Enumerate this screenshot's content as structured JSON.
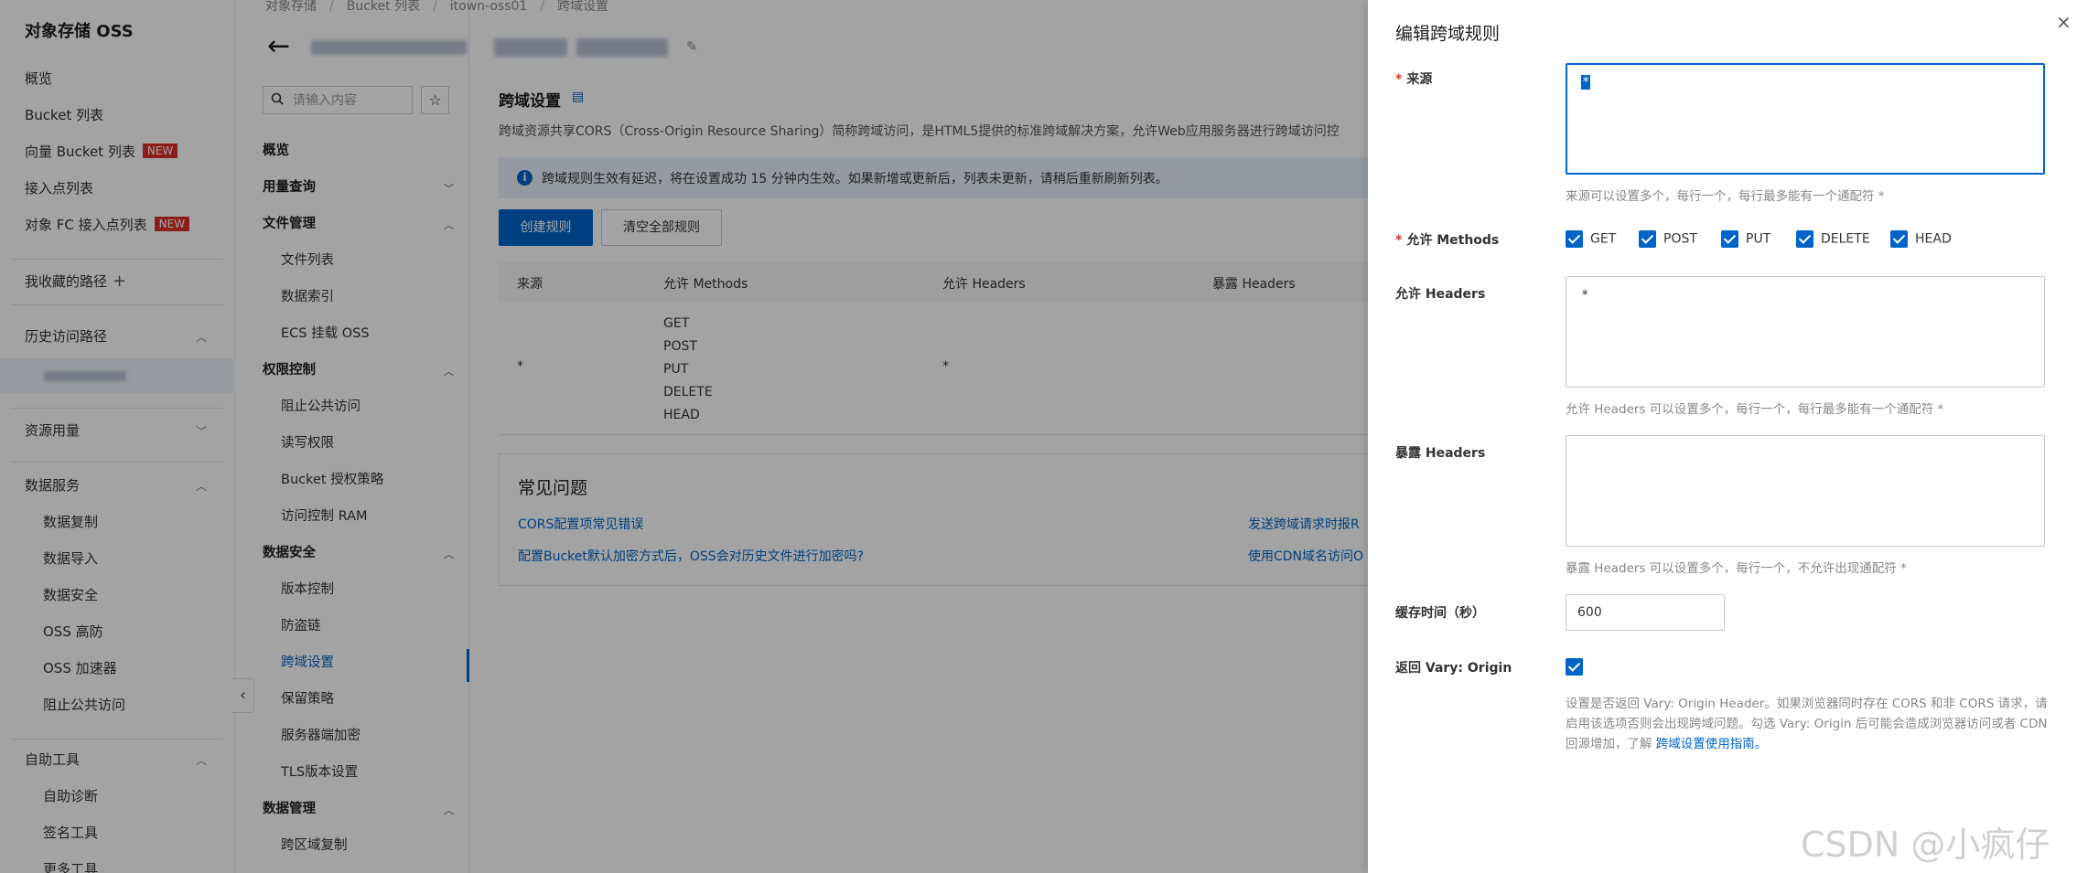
{
  "left_nav": {
    "title": "对象存储 OSS",
    "items": [
      {
        "label": "概览"
      },
      {
        "label": "Bucket 列表"
      },
      {
        "label": "向量 Bucket 列表",
        "badge": "NEW"
      },
      {
        "label": "接入点列表"
      },
      {
        "label": "对象 FC 接入点列表",
        "badge": "NEW"
      }
    ],
    "favorites": "我收藏的路径",
    "history": "历史访问路径",
    "resource_usage": "资源用量",
    "data_service": {
      "label": "数据服务",
      "items": [
        "数据复制",
        "数据导入",
        "数据安全",
        "OSS 高防",
        "OSS 加速器",
        "阻止公共访问"
      ]
    },
    "self_service": {
      "label": "自助工具",
      "items": [
        "自助诊断",
        "签名工具",
        "更多工具"
      ]
    }
  },
  "mid_nav": {
    "search_placeholder": "请输入内容",
    "star": "☆",
    "items": [
      {
        "label": "概览",
        "group": true
      },
      {
        "label": "用量查询",
        "group": true,
        "chevron": "down"
      },
      {
        "label": "文件管理",
        "group": true,
        "chevron": "up"
      },
      {
        "label": "文件列表",
        "sub": true
      },
      {
        "label": "数据索引",
        "sub": true
      },
      {
        "label": "ECS 挂载 OSS",
        "sub": true
      },
      {
        "label": "权限控制",
        "group": true,
        "chevron": "up"
      },
      {
        "label": "阻止公共访问",
        "sub": true
      },
      {
        "label": "读写权限",
        "sub": true
      },
      {
        "label": "Bucket 授权策略",
        "sub": true
      },
      {
        "label": "访问控制 RAM",
        "sub": true
      },
      {
        "label": "数据安全",
        "group": true,
        "chevron": "up"
      },
      {
        "label": "版本控制",
        "sub": true
      },
      {
        "label": "防盗链",
        "sub": true
      },
      {
        "label": "跨域设置",
        "sub": true,
        "active": true
      },
      {
        "label": "保留策略",
        "sub": true
      },
      {
        "label": "服务器端加密",
        "sub": true
      },
      {
        "label": "TLS版本设置",
        "sub": true
      },
      {
        "label": "数据管理",
        "group": true,
        "chevron": "up"
      },
      {
        "label": "跨区域复制",
        "sub": true
      }
    ]
  },
  "main": {
    "breadcrumb": [
      "对象存储",
      "Bucket 列表",
      "itown-oss01",
      "跨域设置"
    ],
    "section_title": "跨域设置",
    "description": "跨域资源共享CORS（Cross-Origin Resource Sharing）简称跨域访问，是HTML5提供的标准跨域解决方案，允许Web应用服务器进行跨域访问控",
    "notice": "跨域规则生效有延迟，将在设置成功 15 分钟内生效。如果新增或更新后，列表未更新，请稍后重新刷新列表。",
    "create_button": "创建规则",
    "clear_button": "清空全部规则",
    "table": {
      "headers": [
        "来源",
        "允许 Methods",
        "允许 Headers",
        "暴露 Headers"
      ],
      "row": {
        "origin": "*",
        "methods": [
          "GET",
          "POST",
          "PUT",
          "DELETE",
          "HEAD"
        ],
        "allow_headers": "*"
      }
    },
    "faq": {
      "title": "常见问题",
      "links": [
        "CORS配置项常见错误",
        "配置Bucket默认加密方式后，OSS会对历史文件进行加密吗?",
        "发送跨域请求时报R",
        "使用CDN域名访问O"
      ]
    }
  },
  "drawer": {
    "title": "编辑跨域规则",
    "close": "×",
    "origin": {
      "label": "来源",
      "value": "*",
      "hint": "来源可以设置多个，每行一个，每行最多能有一个通配符 *"
    },
    "methods": {
      "label": "允许 Methods",
      "options": [
        "GET",
        "POST",
        "PUT",
        "DELETE",
        "HEAD"
      ]
    },
    "allow_headers": {
      "label": "允许 Headers",
      "value": "*",
      "hint": "允许 Headers 可以设置多个，每行一个，每行最多能有一个通配符 *"
    },
    "expose_headers": {
      "label": "暴露 Headers",
      "value": "",
      "hint": "暴露 Headers 可以设置多个，每行一个，不允许出现通配符 *"
    },
    "cache": {
      "label": "缓存时间（秒）",
      "value": "600"
    },
    "vary": {
      "label": "返回 Vary: Origin",
      "desc": "设置是否返回 Vary: Origin Header。如果浏览器同时存在 CORS 和非 CORS 请求，请启用该选项否则会出现跨域问题。勾选 Vary: Origin 后可能会造成浏览器访问或者 CDN 回源增加，了解 ",
      "link": "跨域设置使用指南。"
    }
  },
  "watermark": "CSDN @小疯仔",
  "colors": {
    "accent": "#0064c8",
    "required": "#d93026",
    "overlay": "rgba(0,0,0,0.36)"
  }
}
